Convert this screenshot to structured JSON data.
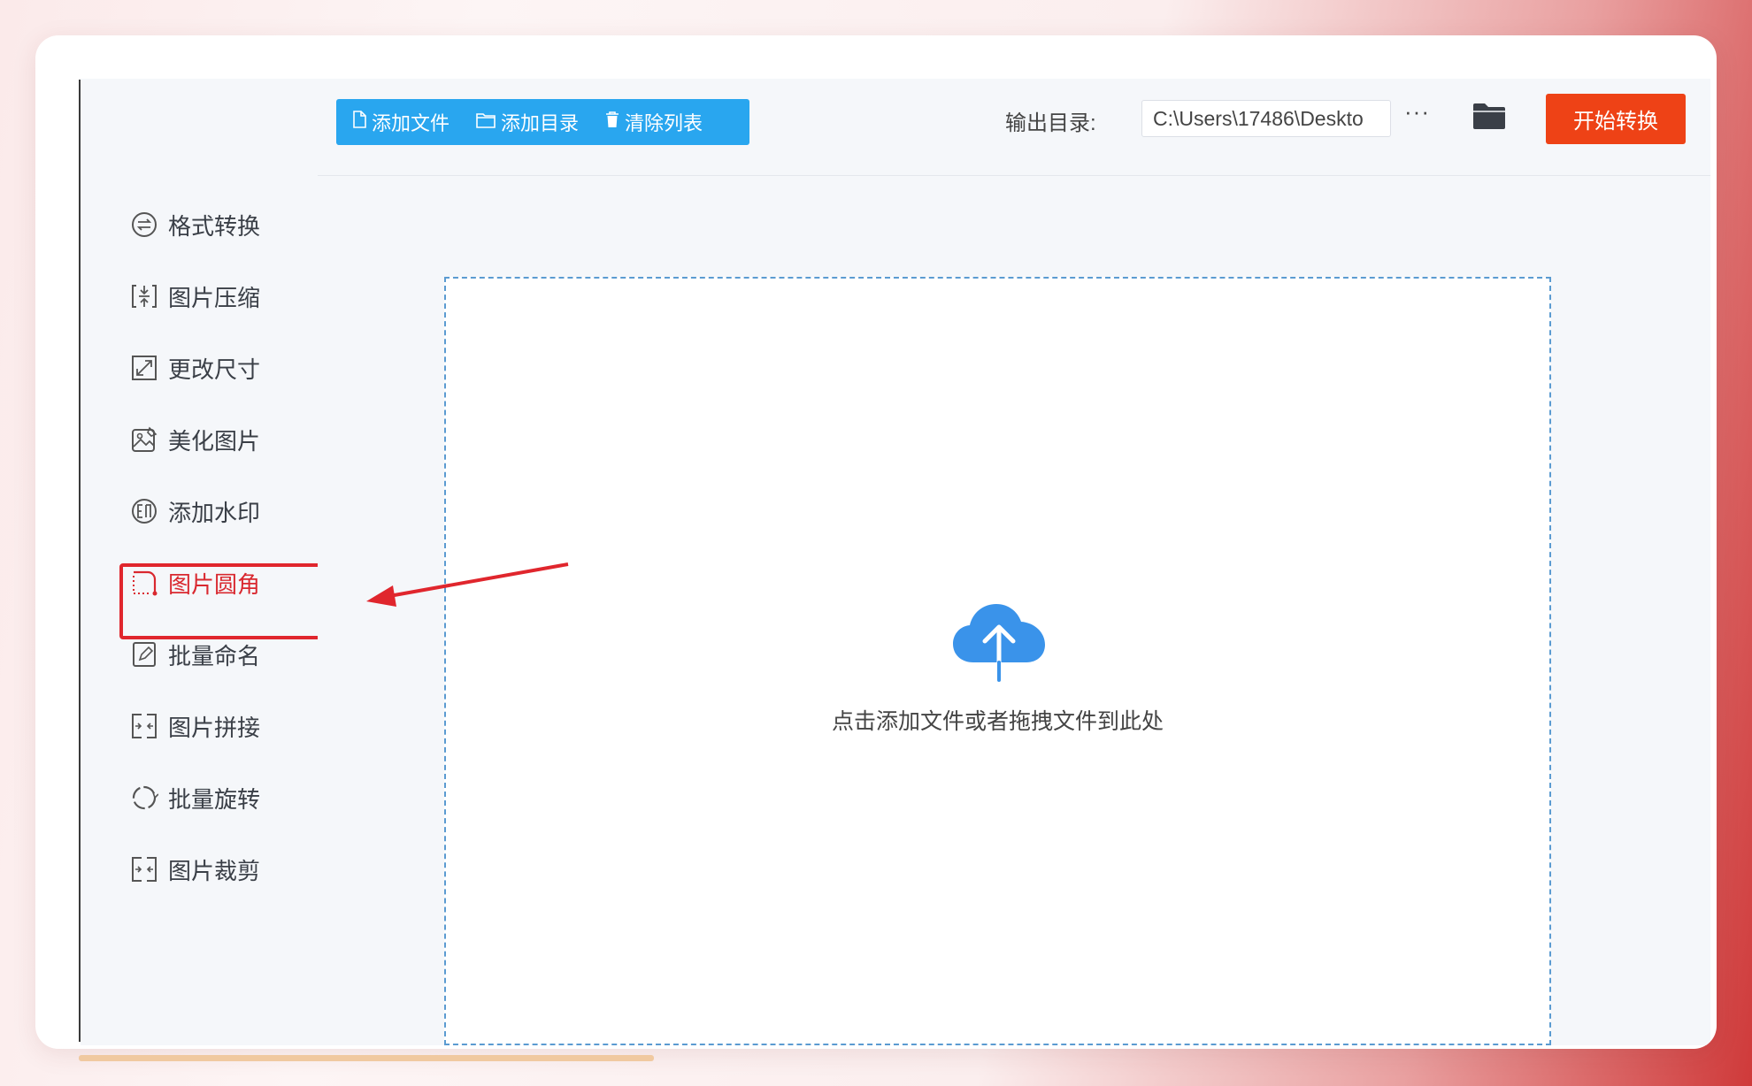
{
  "toolbar": {
    "add_file": "添加文件",
    "add_dir": "添加目录",
    "clear_list": "清除列表",
    "output_label": "输出目录:",
    "output_path": "C:\\Users\\17486\\Deskto",
    "more": "···",
    "start": "开始转换"
  },
  "sidebar": {
    "items": [
      {
        "label": "格式转换",
        "icon": "convert-icon"
      },
      {
        "label": "图片压缩",
        "icon": "compress-icon"
      },
      {
        "label": "更改尺寸",
        "icon": "resize-icon"
      },
      {
        "label": "美化图片",
        "icon": "beautify-icon"
      },
      {
        "label": "添加水印",
        "icon": "watermark-icon"
      },
      {
        "label": "图片圆角",
        "icon": "round-corner-icon",
        "active": true
      },
      {
        "label": "批量命名",
        "icon": "rename-icon"
      },
      {
        "label": "图片拼接",
        "icon": "splice-icon"
      },
      {
        "label": "批量旋转",
        "icon": "rotate-icon"
      },
      {
        "label": "图片裁剪",
        "icon": "crop-icon"
      }
    ]
  },
  "dropzone": {
    "text": "点击添加文件或者拖拽文件到此处",
    "icon": "cloud-upload-icon"
  },
  "colors": {
    "accent_blue": "#29a6ef",
    "start_button": "#ee4216",
    "highlight_red": "#e0262d",
    "active_text": "#d9282f"
  }
}
